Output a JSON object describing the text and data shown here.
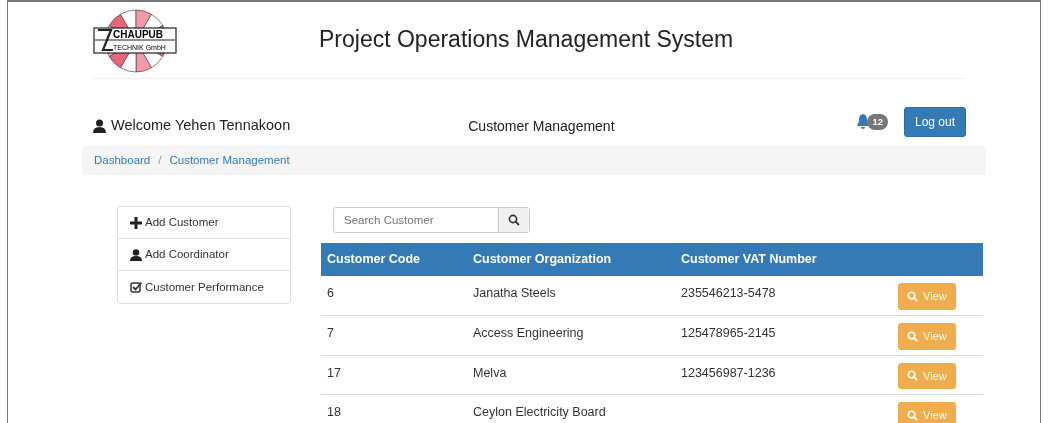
{
  "logo": {
    "line1": "CHAUPUB",
    "line2": "TECHNIK GmbH"
  },
  "title": "Project Operations Management System",
  "welcome": "Welcome Yehen Tennakoon",
  "section": "Customer Management",
  "notifications": {
    "count": "12"
  },
  "logout": "Log out",
  "breadcrumb": {
    "separator": "/",
    "items": [
      {
        "label": "Dashboard"
      },
      {
        "label": "Customer Management"
      }
    ]
  },
  "sidebar": {
    "items": [
      {
        "label": "Add Customer",
        "kind": "plus"
      },
      {
        "label": "Add Coordinator",
        "kind": "user"
      },
      {
        "label": "Customer Performance",
        "kind": "check"
      }
    ]
  },
  "search": {
    "placeholder": "Search Customer"
  },
  "table": {
    "columns": [
      "Customer Code",
      "Customer Organization",
      "Customer VAT Number"
    ],
    "rows": [
      {
        "code": "6",
        "organization": "Janatha Steels",
        "vat": "235546213-5478",
        "action": "View"
      },
      {
        "code": "7",
        "organization": "Access Engineering",
        "vat": "125478965-2145",
        "action": "View"
      },
      {
        "code": "17",
        "organization": "Melva",
        "vat": "123456987-1236",
        "action": "View"
      },
      {
        "code": "18",
        "organization": "Ceylon Electricity Board",
        "action": "View"
      }
    ]
  }
}
